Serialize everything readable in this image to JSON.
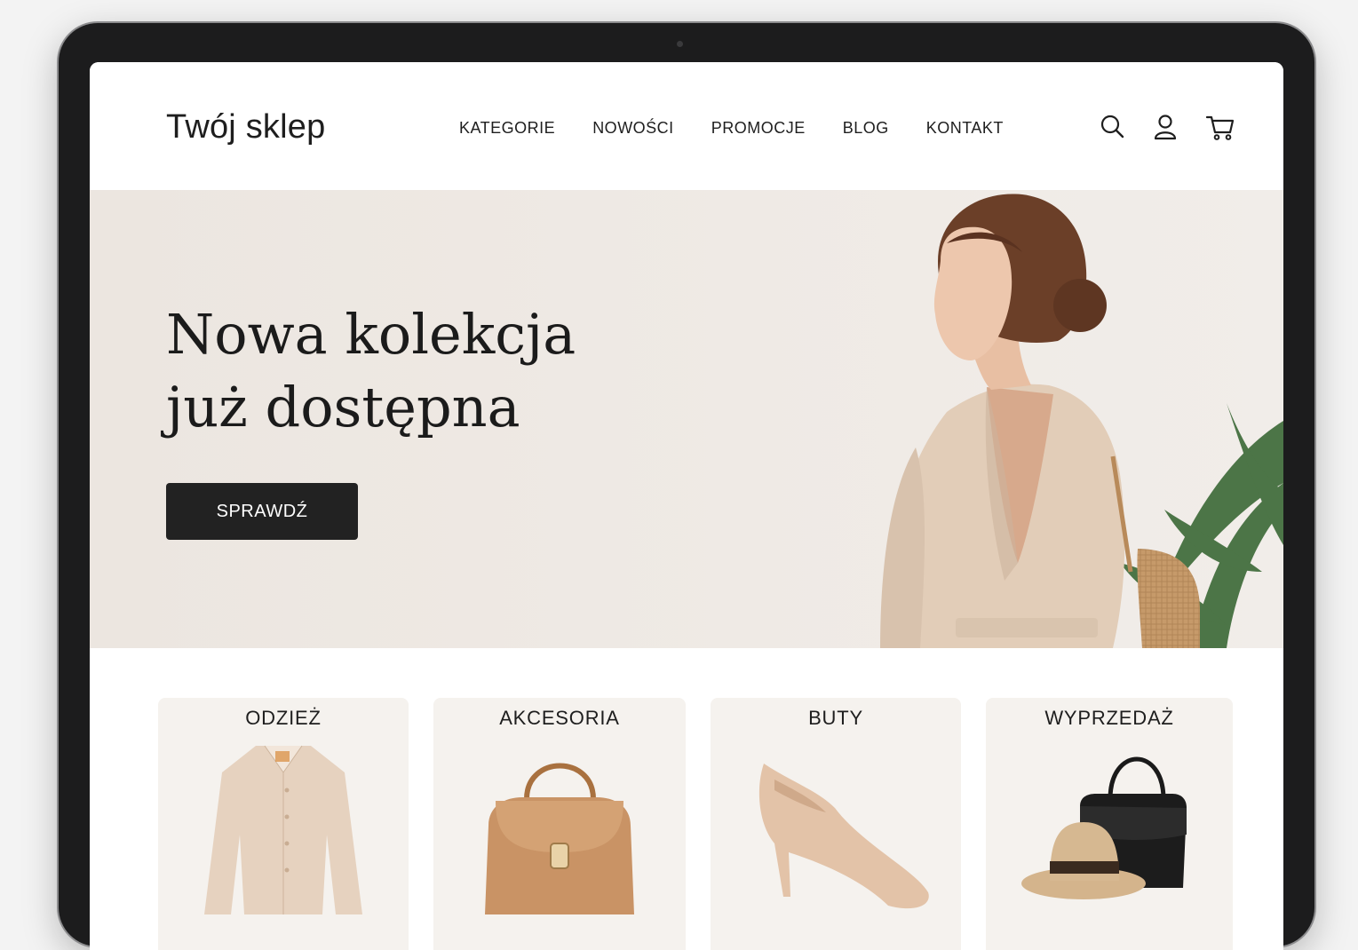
{
  "header": {
    "logo": "Twój sklep",
    "nav": [
      "KATEGORIE",
      "NOWOŚCI",
      "PROMOCJE",
      "BLOG",
      "KONTAKT"
    ],
    "icons": [
      "search-icon",
      "user-icon",
      "cart-icon"
    ]
  },
  "hero": {
    "title_line1": "Nowa kolekcja",
    "title_line2": "już dostępna",
    "cta_label": "SPRAWDŹ",
    "image": "woman-in-beige-dress-photo"
  },
  "categories": [
    {
      "label": "ODZIEŻ",
      "image": "beige-shirt"
    },
    {
      "label": "AKCESORIA",
      "image": "tan-handbag"
    },
    {
      "label": "BUTY",
      "image": "nude-pump-shoe"
    },
    {
      "label": "WYPRZEDAŻ",
      "image": "hat-and-black-bag"
    }
  ],
  "colors": {
    "text": "#1e1e1e",
    "cta_bg": "#222222",
    "hero_bg": "#ece6e0",
    "card_bg": "#f5f2ee"
  }
}
